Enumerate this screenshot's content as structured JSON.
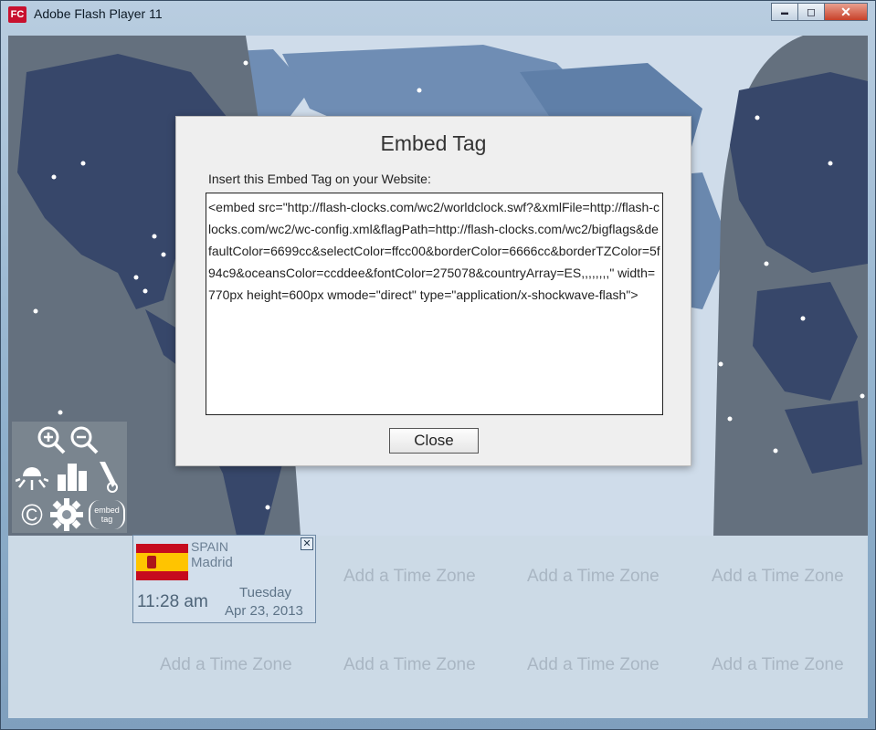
{
  "window": {
    "title": "Adobe Flash Player 11",
    "icon_text": "FC",
    "minimize_glyph": "▬",
    "maximize_glyph": "◻",
    "close_glyph": "✕"
  },
  "dialog": {
    "title": "Embed Tag",
    "label": "Insert this Embed Tag on your Website:",
    "embed_code": "<embed src=\"http://flash-clocks.com/wc2/worldclock.swf?&xmlFile=http://flash-clocks.com/wc2/wc-config.xml&flagPath=http://flash-clocks.com/wc2/bigflags&defaultColor=6699cc&selectColor=ffcc00&borderColor=6666cc&borderTZColor=5f94c9&oceansColor=ccddee&fontColor=275078&countryArray=ES,,,,,,,,\" width=770px height=600px wmode=\"direct\" type=\"application/x-shockwave-flash\">",
    "close_label": "Close"
  },
  "toolbar": {
    "icons": [
      "zoom-in-icon",
      "zoom-out-icon",
      "sun-icon",
      "city-icon",
      "pencil-icon",
      "copyright-icon",
      "gear-icon",
      "embed-tag-icon"
    ],
    "copyright_glyph": "©",
    "embed_tag_line1": "embed",
    "embed_tag_line2": "tag"
  },
  "clock": {
    "country": "SPAIN",
    "city": "Madrid",
    "time": "11:28 am",
    "weekday": "Tuesday",
    "date": "Apr 23, 2013",
    "remove_glyph": "✕",
    "flag_colors": [
      "#c60b1e",
      "#ffc400"
    ]
  },
  "timezones": {
    "add_label": "Add a Time Zone"
  },
  "colors": {
    "land_night": "#37476a",
    "land_day": "#5f7fa8",
    "ocean": "#cfdcea",
    "night_shade": "#616c7a"
  }
}
